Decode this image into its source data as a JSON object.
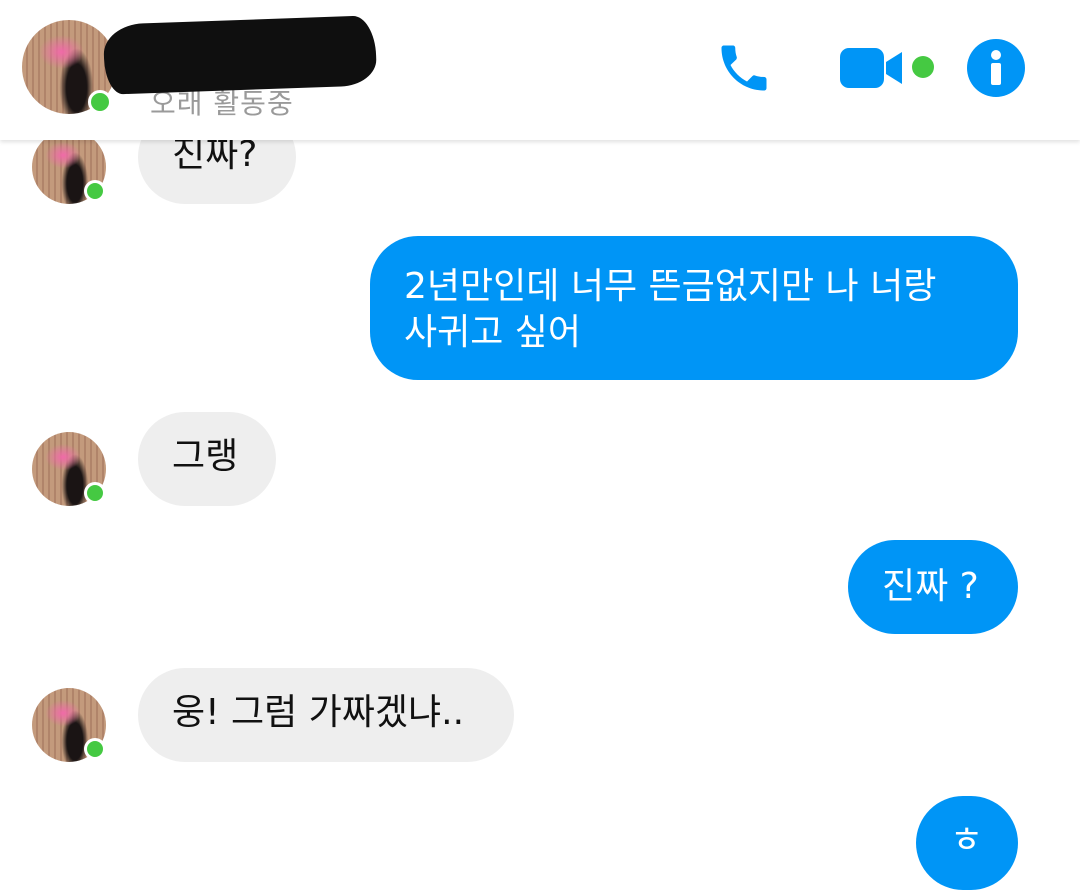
{
  "header": {
    "status_text": "오래 활동중",
    "online_color": "#45c942",
    "accent_color": "#0095f6",
    "icons": [
      "phone-icon",
      "video-camera-icon",
      "info-icon"
    ]
  },
  "messages": [
    {
      "side": "incoming",
      "text": "진짜?"
    },
    {
      "side": "outgoing",
      "text_line1": "2년만인데 너무 뜬금없지만 나 너랑",
      "text_line2": "사귀고 싶어"
    },
    {
      "side": "incoming",
      "text": "그랭"
    },
    {
      "side": "outgoing",
      "text": "진짜 ?"
    },
    {
      "side": "incoming",
      "text": "웅! 그럼 가짜겠냐.."
    },
    {
      "side": "outgoing",
      "text": "ㅎ"
    }
  ]
}
